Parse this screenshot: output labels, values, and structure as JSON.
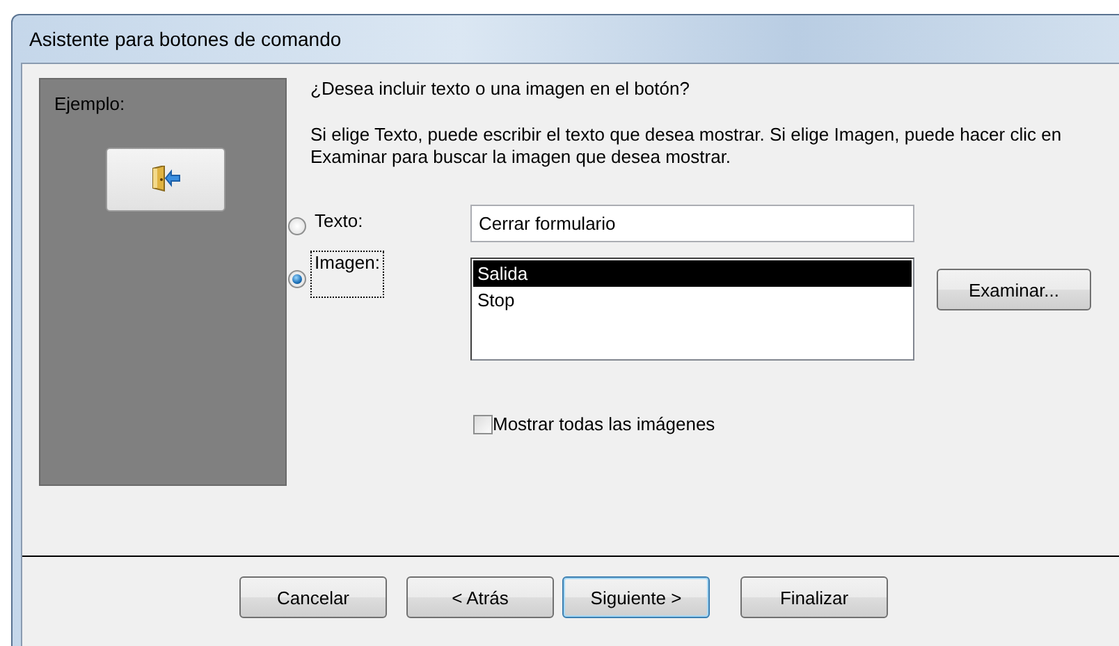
{
  "window": {
    "title": "Asistente para botones de comando"
  },
  "example": {
    "label": "Ejemplo:"
  },
  "question": "¿Desea incluir texto o una imagen en el botón?",
  "instructions": "Si elige Texto, puede escribir el texto que desea mostrar. Si elige Imagen, puede hacer clic en Examinar para buscar la imagen que desea mostrar.",
  "options": [
    {
      "kind": "field",
      "label": "Texto:",
      "selected": false,
      "focused": false,
      "value": "Cerrar formulario"
    },
    {
      "kind": "list",
      "label": "Imagen:",
      "selected": true,
      "focused": true,
      "items": [
        {
          "label": "Salida",
          "selected": true
        },
        {
          "label": "Stop",
          "selected": false
        }
      ],
      "button": "Examinar..."
    }
  ],
  "show_all": {
    "label": "Mostrar todas las imágenes",
    "checked": false
  },
  "buttons": [
    {
      "label": "Cancelar",
      "default": false
    },
    {
      "label": "< Atrás",
      "default": false
    },
    {
      "label": "Siguiente >",
      "default": true
    },
    {
      "label": "Finalizar",
      "default": false
    }
  ]
}
